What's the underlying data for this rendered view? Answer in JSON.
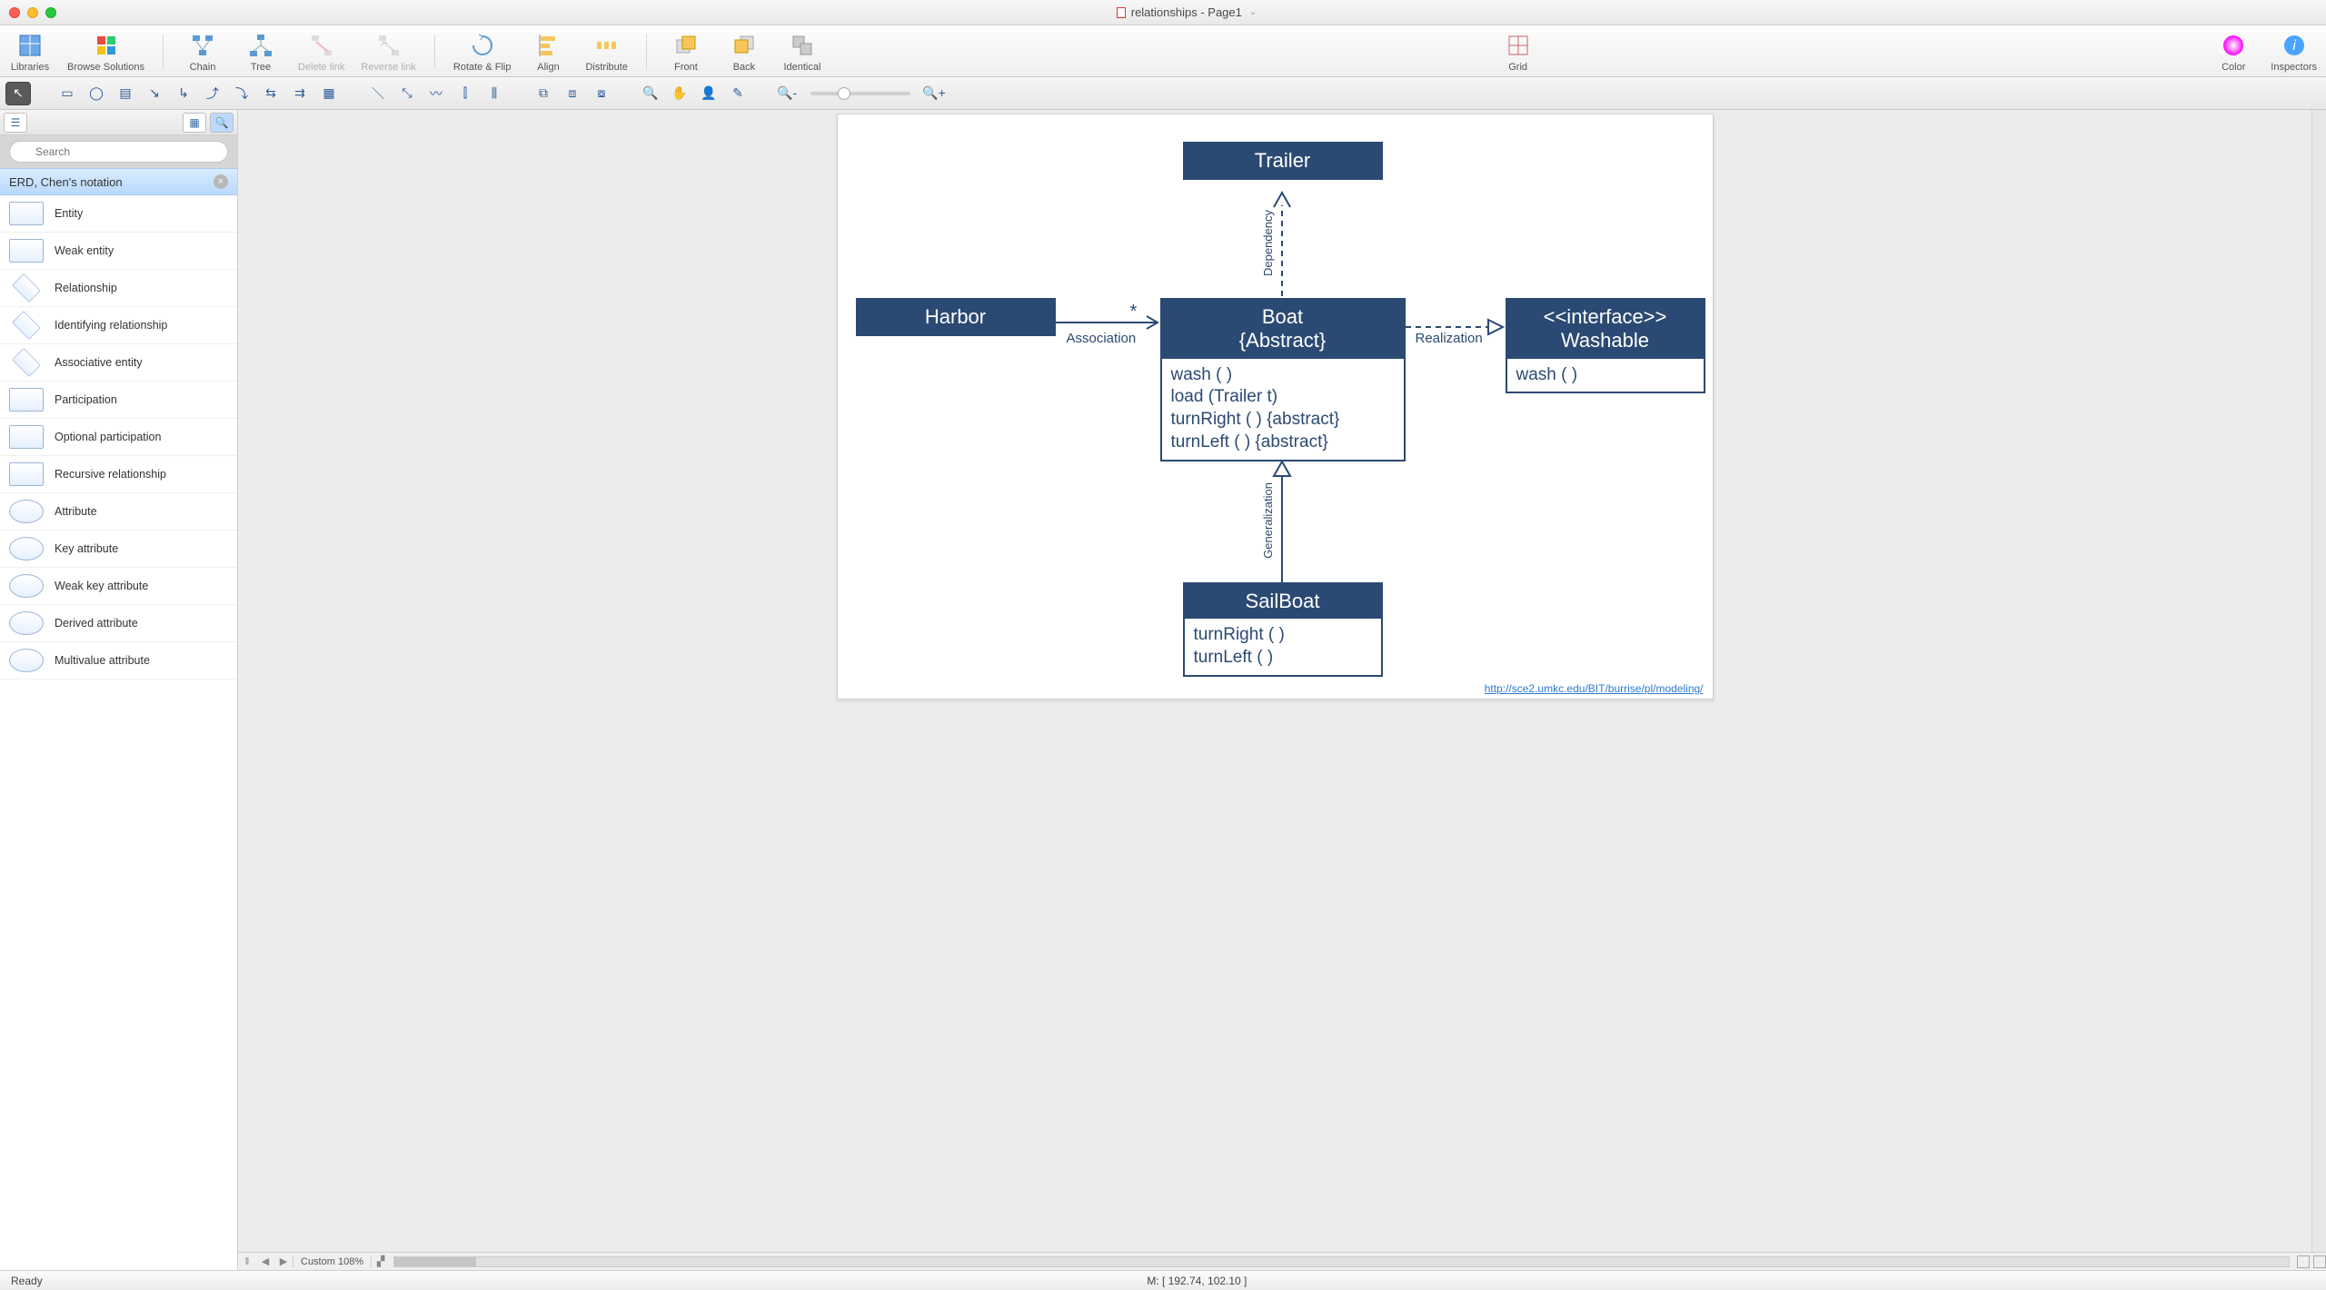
{
  "window": {
    "title": "relationships - Page1"
  },
  "toolbar": [
    {
      "id": "libraries",
      "label": "Libraries",
      "enabled": true
    },
    {
      "id": "browse",
      "label": "Browse Solutions",
      "enabled": true
    },
    {
      "sep": true
    },
    {
      "id": "chain",
      "label": "Chain",
      "enabled": true
    },
    {
      "id": "tree",
      "label": "Tree",
      "enabled": true
    },
    {
      "id": "delete-link",
      "label": "Delete link",
      "enabled": false
    },
    {
      "id": "reverse-link",
      "label": "Reverse link",
      "enabled": false
    },
    {
      "sep": true
    },
    {
      "id": "rotate-flip",
      "label": "Rotate & Flip",
      "enabled": true
    },
    {
      "id": "align",
      "label": "Align",
      "enabled": true
    },
    {
      "id": "distribute",
      "label": "Distribute",
      "enabled": true
    },
    {
      "sep": true
    },
    {
      "id": "front",
      "label": "Front",
      "enabled": true
    },
    {
      "id": "back",
      "label": "Back",
      "enabled": true
    },
    {
      "id": "identical",
      "label": "Identical",
      "enabled": true
    },
    {
      "spacer": true
    },
    {
      "id": "grid",
      "label": "Grid",
      "enabled": true
    },
    {
      "spacer": true
    },
    {
      "id": "color",
      "label": "Color",
      "enabled": true
    },
    {
      "id": "inspectors",
      "label": "Inspectors",
      "enabled": true
    }
  ],
  "search": {
    "placeholder": "Search"
  },
  "library": {
    "title": "ERD, Chen's notation",
    "shapes": [
      {
        "label": "Entity",
        "kind": "rect"
      },
      {
        "label": "Weak entity",
        "kind": "rect"
      },
      {
        "label": "Relationship",
        "kind": "diamond"
      },
      {
        "label": "Identifying relationship",
        "kind": "diamond"
      },
      {
        "label": "Associative entity",
        "kind": "diamond"
      },
      {
        "label": "Participation",
        "kind": "rect"
      },
      {
        "label": "Optional participation",
        "kind": "rect"
      },
      {
        "label": "Recursive relationship",
        "kind": "rect"
      },
      {
        "label": "Attribute",
        "kind": "ellipse"
      },
      {
        "label": "Key attribute",
        "kind": "ellipse"
      },
      {
        "label": "Weak key attribute",
        "kind": "ellipse"
      },
      {
        "label": "Derived attribute",
        "kind": "ellipse"
      },
      {
        "label": "Multivalue attribute",
        "kind": "ellipse"
      }
    ]
  },
  "diagram": {
    "trailer": {
      "title": "Trailer"
    },
    "harbor": {
      "title": "Harbor"
    },
    "boat": {
      "title": "Boat",
      "sub": "{Abstract}",
      "ops": [
        "wash ( )",
        "load (Trailer t)",
        "turnRight ( ) {abstract}",
        "turnLeft ( ) {abstract}"
      ]
    },
    "washable": {
      "stereo": "<<interface>>",
      "title": "Washable",
      "ops": [
        "wash ( )"
      ]
    },
    "sailboat": {
      "title": "SailBoat",
      "ops": [
        "turnRight ( )",
        "turnLeft ( )"
      ]
    },
    "labels": {
      "association": "Association",
      "realization": "Realization",
      "dependency": "Dependency",
      "generalization": "Generalization",
      "mult": "*"
    },
    "link": "http://sce2.umkc.edu/BIT/burrise/pl/modeling/"
  },
  "bottom": {
    "zoom": "Custom 108%"
  },
  "status": {
    "ready": "Ready",
    "mouse": "M: [ 192.74, 102.10 ]"
  }
}
